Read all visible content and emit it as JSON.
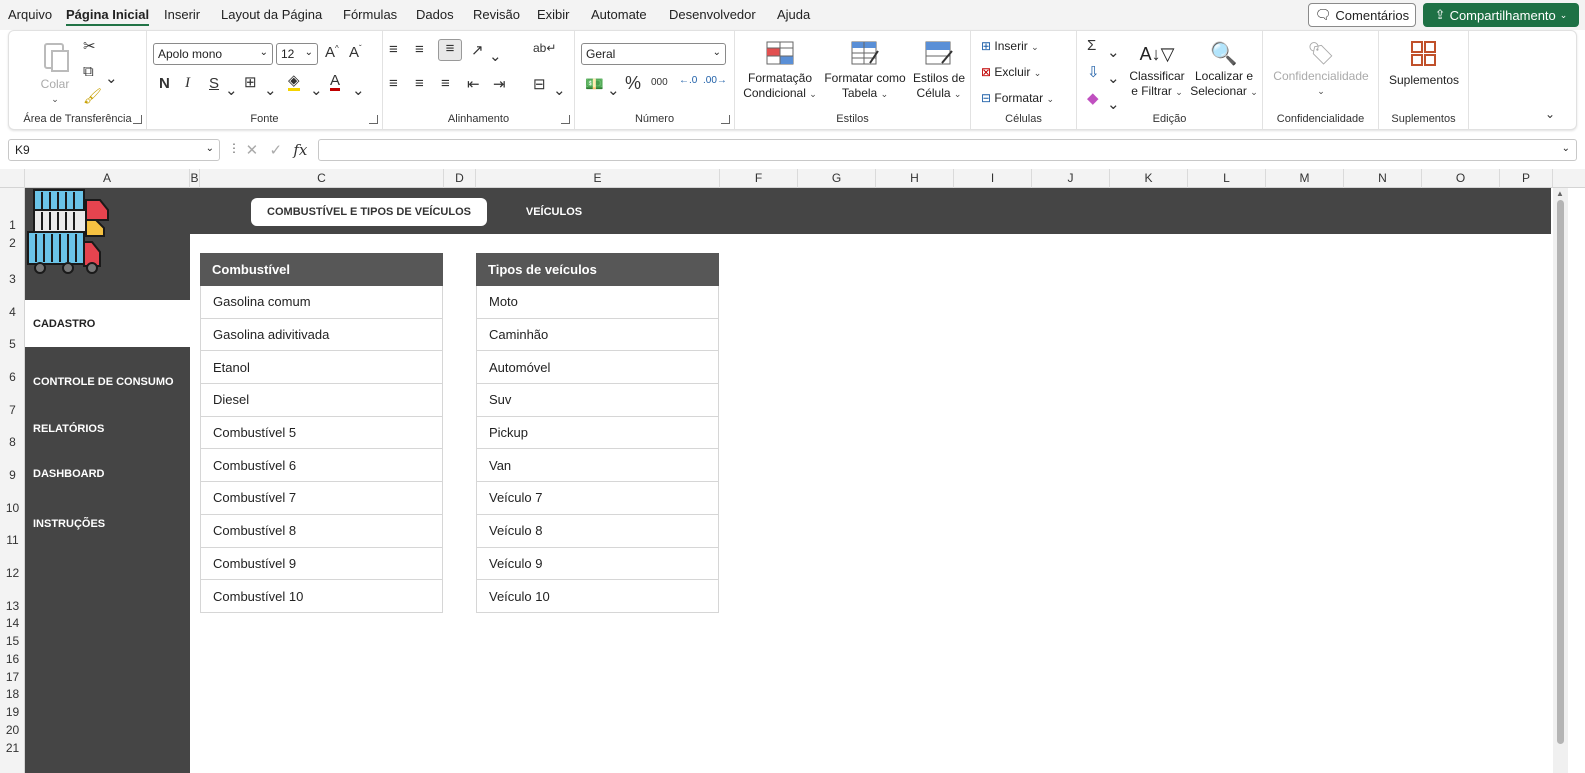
{
  "menu": {
    "items": [
      "Arquivo",
      "Página Inicial",
      "Inserir",
      "Layout da Página",
      "Fórmulas",
      "Dados",
      "Revisão",
      "Exibir",
      "Automate",
      "Desenvolvedor",
      "Ajuda"
    ],
    "comments_label": "Comentários",
    "share_label": "Compartilhamento"
  },
  "ribbon": {
    "clipboard": {
      "paste": "Colar",
      "group": "Área de Transferência"
    },
    "font": {
      "name": "Apolo mono",
      "size": "12",
      "bold": "N",
      "italic": "I",
      "underline": "S",
      "group": "Fonte"
    },
    "alignment": {
      "group": "Alinhamento"
    },
    "number": {
      "format": "Geral",
      "group": "Número",
      "thousands": "000"
    },
    "styles": {
      "cond_format": [
        "Formatação",
        "Condicional"
      ],
      "format_table": [
        "Formatar como",
        "Tabela"
      ],
      "cell_styles": [
        "Estilos de",
        "Célula"
      ],
      "group": "Estilos"
    },
    "cells": {
      "insert": "Inserir",
      "delete": "Excluir",
      "format": "Formatar",
      "group": "Células"
    },
    "editing": {
      "sort": [
        "Classificar",
        "e Filtrar"
      ],
      "find": [
        "Localizar e",
        "Selecionar"
      ],
      "group": "Edição"
    },
    "sensitivity": {
      "label": "Confidencialidade",
      "group": "Confidencialidade"
    },
    "addins": {
      "label": "Suplementos",
      "group": "Suplementos"
    }
  },
  "formula_bar": {
    "cell_ref": "K9",
    "fx": "fx",
    "value": ""
  },
  "columns": [
    "A",
    "B",
    "C",
    "D",
    "E",
    "F",
    "G",
    "H",
    "I",
    "J",
    "K",
    "L",
    "M",
    "N",
    "O",
    "P"
  ],
  "rows": [
    "1",
    "2",
    "3",
    "4",
    "5",
    "6",
    "7",
    "8",
    "9",
    "10",
    "11",
    "12",
    "13",
    "14",
    "15",
    "16",
    "17",
    "18",
    "19",
    "20",
    "21"
  ],
  "sheet": {
    "tabs": [
      "COMBUSTÍVEL E TIPOS DE VEÍCULOS",
      "VEÍCULOS"
    ],
    "nav": [
      "CADASTRO",
      "CONTROLE DE CONSUMO",
      "RELATÓRIOS",
      "DASHBOARD",
      "INSTRUÇÕES"
    ],
    "fuel_table": {
      "header": "Combustível",
      "rows": [
        "Gasolina comum",
        "Gasolina adivitivada",
        "Etanol",
        "Diesel",
        "Combustível 5",
        "Combustível 6",
        "Combustível 7",
        "Combustível 8",
        "Combustível 9",
        "Combustível 10"
      ]
    },
    "vehicle_table": {
      "header": "Tipos de veículos",
      "rows": [
        "Moto",
        "Caminhão",
        "Automóvel",
        "Suv",
        "Pickup",
        "Van",
        "Veículo 7",
        "Veículo 8",
        "Veículo 9",
        "Veículo 10"
      ]
    }
  }
}
